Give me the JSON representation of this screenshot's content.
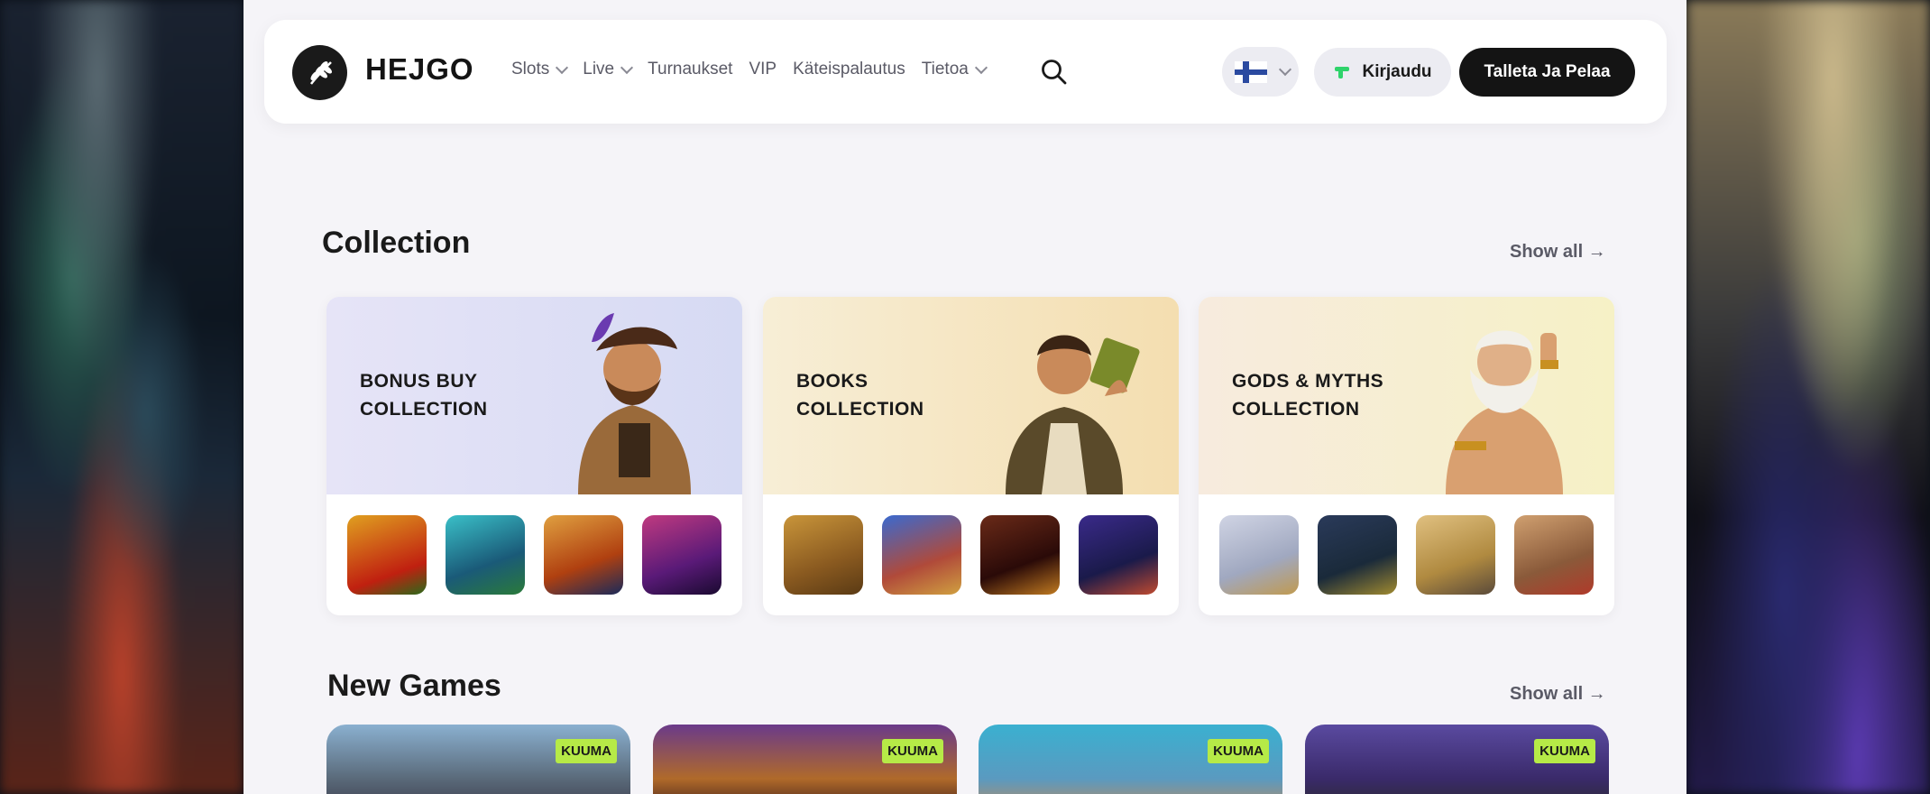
{
  "header": {
    "brand": "HEJGO",
    "nav": [
      {
        "label": "Slots",
        "dropdown": true
      },
      {
        "label": "Live",
        "dropdown": true
      },
      {
        "label": "Turnaukset",
        "dropdown": false
      },
      {
        "label": "VIP",
        "dropdown": false
      },
      {
        "label": "Käteispalautus",
        "dropdown": false
      },
      {
        "label": "Tietoa",
        "dropdown": true
      }
    ],
    "login_label": "Kirjaudu",
    "deposit_label": "Talleta Ja Pelaa",
    "language_flag": "finland-flag-icon"
  },
  "collection": {
    "title": "Collection",
    "show_all": "Show all →",
    "cards": [
      {
        "line1": "BONUS BUY",
        "line2": "COLLECTION",
        "hero_colors": [
          "#e4e2f6",
          "#d8dbf2"
        ],
        "thumbs": [
          "big-juice-game",
          "mighty-gorilla-game",
          "solar-queen-megaways-game",
          "fortuna-game"
        ]
      },
      {
        "line1": "BOOKS",
        "line2": "COLLECTION",
        "hero_colors": [
          "#f6ecd2",
          "#f4e0b4"
        ],
        "thumbs": [
          "book-of-dead-game",
          "book-of-oracle-game",
          "book-of-truth-game",
          "book-of-spells-game"
        ]
      },
      {
        "line1": "GODS & MYTHS",
        "line2": "COLLECTION",
        "hero_colors": [
          "#f6eadc",
          "#f6f0c8"
        ],
        "thumbs": [
          "pegasus-game",
          "temple-game",
          "zeus-lightning-game",
          "gods-game"
        ]
      }
    ]
  },
  "new_games": {
    "title": "New Games",
    "show_all": "Show all →",
    "badge": "KUUMA",
    "cards": [
      "new-game-1",
      "new-game-2",
      "new-game-3",
      "new-game-4"
    ]
  }
}
